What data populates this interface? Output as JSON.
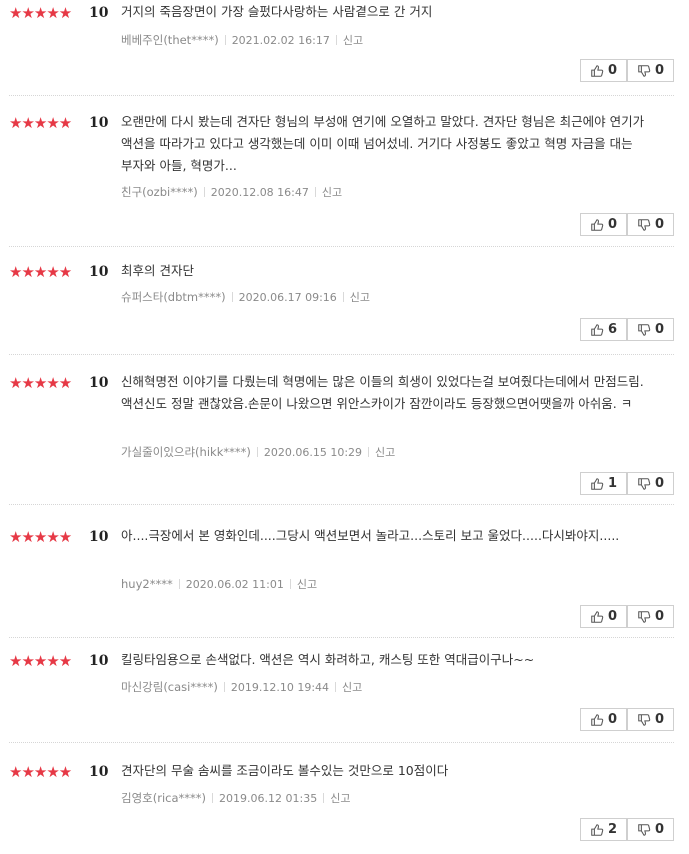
{
  "star_glyphs": "★★★★★",
  "colors": {
    "star": "#e63946",
    "text": "#333333",
    "meta": "#8a8a8a",
    "border": "#cfcfcf"
  },
  "icons": {
    "like": "thumbs-up-icon",
    "dislike": "thumbs-down-icon"
  },
  "report_label": "신고",
  "reviews": [
    {
      "score": "10",
      "stars": 5,
      "text": "거지의 죽음장면이 가장 슬펐다사랑하는 사람곁으로 간 거지",
      "author": "베베주인(thet****)",
      "date": "2021.02.02 16:17",
      "likes": "0",
      "dislikes": "0"
    },
    {
      "score": "10",
      "stars": 5,
      "text": "오랜만에 다시 봤는데 견자단 형님의 부성애 연기에 오열하고 말았다. 견자단 형님은 최근에야 연기가 액션을 따라가고 있다고 생각했는데 이미 이때 넘어섰네. 거기다 사정봉도 좋았고 혁명 자금을 대는 부자와 아들, 혁명가...",
      "author": "친구(ozbi****)",
      "date": "2020.12.08 16:47",
      "likes": "0",
      "dislikes": "0"
    },
    {
      "score": "10",
      "stars": 5,
      "text": "최후의 견자단",
      "author": "슈퍼스타(dbtm****)",
      "date": "2020.06.17 09:16",
      "likes": "6",
      "dislikes": "0"
    },
    {
      "score": "10",
      "stars": 5,
      "text": "신해혁명전 이야기를 다뤘는데 혁명에는 많은 이들의 희생이 있었다는걸 보여줬다는데에서 만점드림.액션신도 정말 괜찮았음.손문이 나왔으면 위안스카이가 잠깐이라도 등장했으면어땟을까 아쉬움. ㅋ",
      "author": "가실줄이있으랴(hikk****)",
      "date": "2020.06.15 10:29",
      "likes": "1",
      "dislikes": "0"
    },
    {
      "score": "10",
      "stars": 5,
      "text": "아....극장에서 본 영화인데....그당시 액션보면서 놀라고...스토리 보고 울었다.....다시봐야지.....",
      "author": "huy2****",
      "date": "2020.06.02 11:01",
      "likes": "0",
      "dislikes": "0"
    },
    {
      "score": "10",
      "stars": 5,
      "text": "킬링타임용으로 손색없다. 액션은 역시 화려하고, 캐스팅 또한 역대급이구나~~",
      "author": "마신강림(casi****)",
      "date": "2019.12.10 19:44",
      "likes": "0",
      "dislikes": "0"
    },
    {
      "score": "10",
      "stars": 5,
      "text": "견자단의 무술 솜씨를 조금이라도 볼수있는 것만으로 10점이다",
      "author": "김영호(rica****)",
      "date": "2019.06.12 01:35",
      "likes": "2",
      "dislikes": "0"
    }
  ]
}
